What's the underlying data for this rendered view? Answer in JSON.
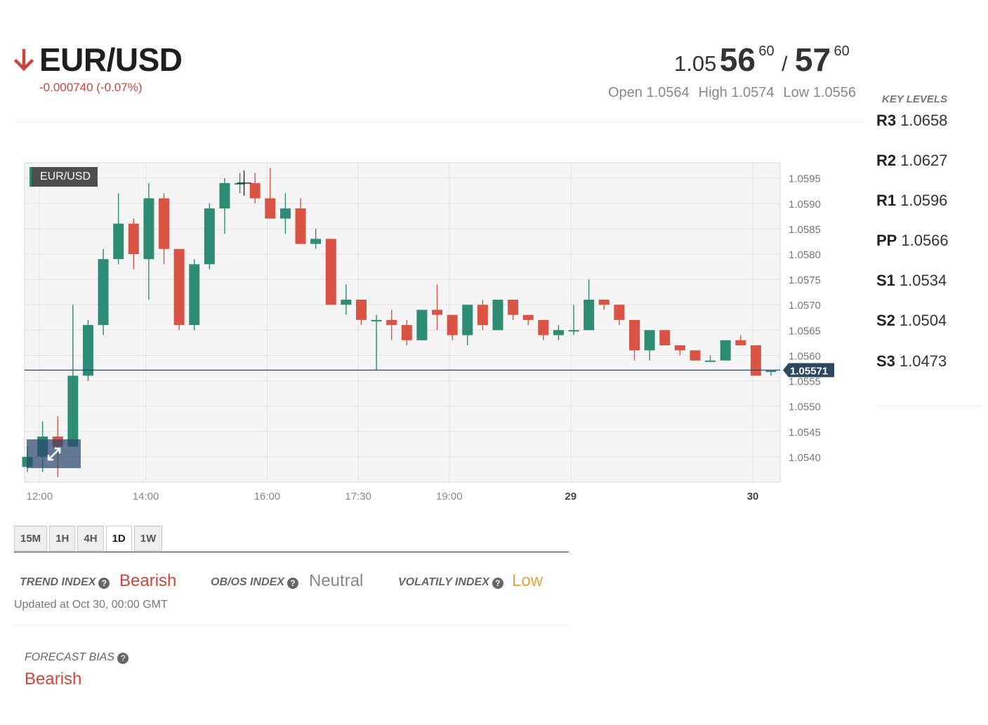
{
  "header": {
    "pair": "EUR/USD",
    "change": "-0.000740 (-0.07%)",
    "direction_icon": "arrow-down-icon",
    "bid_prefix": "1.05",
    "bid_big": "56",
    "bid_sup": "60",
    "slash": "/",
    "ask_big": "57",
    "ask_sup": "60",
    "open": "Open 1.0564",
    "high": "High 1.0574",
    "low": "Low 1.0556",
    "down_color": "#c9473a"
  },
  "key_levels": {
    "title": "KEY LEVELS",
    "levels": [
      {
        "name": "R3",
        "value": "1.0658"
      },
      {
        "name": "R2",
        "value": "1.0627"
      },
      {
        "name": "R1",
        "value": "1.0596"
      },
      {
        "name": "PP",
        "value": "1.0566"
      },
      {
        "name": "S1",
        "value": "1.0534"
      },
      {
        "name": "S2",
        "value": "1.0504"
      },
      {
        "name": "S3",
        "value": "1.0473"
      }
    ]
  },
  "chart_label": "EUR/USD",
  "chart_data": {
    "type": "candlestick",
    "symbol": "EUR/USD",
    "ylim": [
      1.0535,
      1.0598
    ],
    "y_ticks": [
      "1.0595",
      "1.0590",
      "1.0585",
      "1.0580",
      "1.0575",
      "1.0570",
      "1.0565",
      "1.0560",
      "1.0555",
      "1.0550",
      "1.0545",
      "1.0540"
    ],
    "x_ticks": [
      "12:00",
      "14:00",
      "16:00",
      "17:30",
      "19:00",
      "29",
      "30"
    ],
    "x_ticks_bold": [
      "29",
      "30"
    ],
    "last_price": 1.05571,
    "last_price_label": "1.05571",
    "up_color": "#2e8b74",
    "down_color": "#d95444",
    "grid": true,
    "candles": [
      {
        "o": 1.0538,
        "h": 1.0542,
        "l": 1.0537,
        "c": 1.054
      },
      {
        "o": 1.054,
        "h": 1.0547,
        "l": 1.0537,
        "c": 1.0544
      },
      {
        "o": 1.0544,
        "h": 1.0548,
        "l": 1.0536,
        "c": 1.0542
      },
      {
        "o": 1.0542,
        "h": 1.057,
        "l": 1.0542,
        "c": 1.0556
      },
      {
        "o": 1.0556,
        "h": 1.0567,
        "l": 1.0555,
        "c": 1.0566
      },
      {
        "o": 1.0566,
        "h": 1.0581,
        "l": 1.0564,
        "c": 1.0579
      },
      {
        "o": 1.0579,
        "h": 1.0592,
        "l": 1.0578,
        "c": 1.0586
      },
      {
        "o": 1.0586,
        "h": 1.0587,
        "l": 1.0577,
        "c": 1.058
      },
      {
        "o": 1.0579,
        "h": 1.0594,
        "l": 1.0571,
        "c": 1.0591
      },
      {
        "o": 1.0591,
        "h": 1.0592,
        "l": 1.0578,
        "c": 1.0581
      },
      {
        "o": 1.0581,
        "h": 1.0581,
        "l": 1.0565,
        "c": 1.0566
      },
      {
        "o": 1.0566,
        "h": 1.0579,
        "l": 1.0565,
        "c": 1.0578
      },
      {
        "o": 1.0578,
        "h": 1.059,
        "l": 1.0577,
        "c": 1.0589
      },
      {
        "o": 1.0589,
        "h": 1.0595,
        "l": 1.0584,
        "c": 1.0594
      },
      {
        "o": 1.0594,
        "h": 1.0596,
        "l": 1.0592,
        "c": 1.0594
      },
      {
        "o": 1.0594,
        "h": 1.0596,
        "l": 1.059,
        "c": 1.0591
      },
      {
        "o": 1.0591,
        "h": 1.0597,
        "l": 1.0587,
        "c": 1.0587
      },
      {
        "o": 1.0587,
        "h": 1.0592,
        "l": 1.0584,
        "c": 1.0589
      },
      {
        "o": 1.0589,
        "h": 1.0591,
        "l": 1.0582,
        "c": 1.0582
      },
      {
        "o": 1.0582,
        "h": 1.0585,
        "l": 1.0581,
        "c": 1.0583
      },
      {
        "o": 1.0583,
        "h": 1.0583,
        "l": 1.057,
        "c": 1.057
      },
      {
        "o": 1.057,
        "h": 1.0574,
        "l": 1.0568,
        "c": 1.0571
      },
      {
        "o": 1.0571,
        "h": 1.0571,
        "l": 1.0566,
        "c": 1.0567
      },
      {
        "o": 1.0567,
        "h": 1.0568,
        "l": 1.0557,
        "c": 1.0567
      },
      {
        "o": 1.0567,
        "h": 1.0569,
        "l": 1.0563,
        "c": 1.0566
      },
      {
        "o": 1.0566,
        "h": 1.0567,
        "l": 1.0562,
        "c": 1.0563
      },
      {
        "o": 1.0563,
        "h": 1.0569,
        "l": 1.0563,
        "c": 1.0569
      },
      {
        "o": 1.0569,
        "h": 1.0574,
        "l": 1.0565,
        "c": 1.0568
      },
      {
        "o": 1.0568,
        "h": 1.0568,
        "l": 1.0563,
        "c": 1.0564
      },
      {
        "o": 1.0564,
        "h": 1.057,
        "l": 1.0562,
        "c": 1.057
      },
      {
        "o": 1.057,
        "h": 1.0571,
        "l": 1.0565,
        "c": 1.0566
      },
      {
        "o": 1.0565,
        "h": 1.0571,
        "l": 1.0565,
        "c": 1.0571
      },
      {
        "o": 1.0571,
        "h": 1.0571,
        "l": 1.0567,
        "c": 1.0568
      },
      {
        "o": 1.0568,
        "h": 1.0568,
        "l": 1.0566,
        "c": 1.0567
      },
      {
        "o": 1.0567,
        "h": 1.0567,
        "l": 1.0563,
        "c": 1.0564
      },
      {
        "o": 1.0564,
        "h": 1.0566,
        "l": 1.0563,
        "c": 1.0565
      },
      {
        "o": 1.0565,
        "h": 1.057,
        "l": 1.0564,
        "c": 1.0565
      },
      {
        "o": 1.0565,
        "h": 1.0575,
        "l": 1.0565,
        "c": 1.0571
      },
      {
        "o": 1.0571,
        "h": 1.0571,
        "l": 1.0569,
        "c": 1.057
      },
      {
        "o": 1.057,
        "h": 1.057,
        "l": 1.0566,
        "c": 1.0567
      },
      {
        "o": 1.0567,
        "h": 1.0567,
        "l": 1.0559,
        "c": 1.0561
      },
      {
        "o": 1.0561,
        "h": 1.0565,
        "l": 1.0559,
        "c": 1.0565
      },
      {
        "o": 1.0565,
        "h": 1.0565,
        "l": 1.0562,
        "c": 1.0562
      },
      {
        "o": 1.0562,
        "h": 1.0562,
        "l": 1.056,
        "c": 1.0561
      },
      {
        "o": 1.0561,
        "h": 1.0561,
        "l": 1.0559,
        "c": 1.0559
      },
      {
        "o": 1.0559,
        "h": 1.056,
        "l": 1.0559,
        "c": 1.0559
      },
      {
        "o": 1.0559,
        "h": 1.0563,
        "l": 1.0559,
        "c": 1.0563
      },
      {
        "o": 1.0563,
        "h": 1.0564,
        "l": 1.0562,
        "c": 1.0562
      },
      {
        "o": 1.0562,
        "h": 1.0562,
        "l": 1.0556,
        "c": 1.0556
      },
      {
        "o": 1.0557,
        "h": 1.0557,
        "l": 1.0556,
        "c": 1.0557
      }
    ]
  },
  "timeframes": [
    "15M",
    "1H",
    "4H",
    "1D",
    "1W"
  ],
  "active_timeframe": "1D",
  "indexes": {
    "trend_label": "TREND INDEX",
    "trend_value": "Bearish",
    "obos_label": "OB/OS INDEX",
    "obos_value": "Neutral",
    "volatility_label": "VOLATILY INDEX",
    "volatility_value": "Low",
    "help_icon": "question-circle-icon",
    "colors": {
      "bearish": "#c9473a",
      "neutral": "#888888",
      "low": "#e6a23c"
    }
  },
  "updated": "Updated at Oct 30, 00:00 GMT",
  "forecast": {
    "label": "FORECAST BIAS",
    "value": "Bearish"
  }
}
